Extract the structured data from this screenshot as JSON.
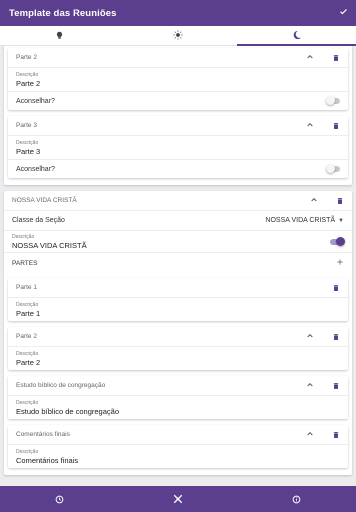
{
  "appbar": {
    "title": "Template das Reuniões",
    "check_icon": "check-icon"
  },
  "tabs": [
    {
      "icon": "lightbulb-icon"
    },
    {
      "icon": "sun-icon"
    },
    {
      "icon": "moon-icon",
      "active": true
    }
  ],
  "top_cards": [
    {
      "title": "Parte 2",
      "desc_label": "Descrição",
      "desc_value": "Parte 2",
      "advise_label": "Aconselhar?",
      "advise_on": false
    },
    {
      "title": "Parte 3",
      "desc_label": "Descrição",
      "desc_value": "Parte 3",
      "advise_label": "Aconselhar?",
      "advise_on": false
    }
  ],
  "section": {
    "title": "NOSSA VIDA CRISTÃ",
    "class_label": "Classe da Seção",
    "class_value": "NOSSA VIDA CRISTÃ",
    "desc_label": "Descrição",
    "desc_value": "NOSSA VIDA CRISTÃ",
    "desc_toggle_on": true,
    "partes_label": "PARTES",
    "parts": [
      {
        "title": "Parte 1",
        "desc_label": "Descrição",
        "desc_value": "Parte 1"
      },
      {
        "title": "Parte 2",
        "desc_label": "Descrição",
        "desc_value": "Parte 2"
      },
      {
        "title": "Estudo bíblico de congregação",
        "desc_label": "Descrição",
        "desc_value": "Estudo bíblico de congregação"
      },
      {
        "title": "Comentários finais",
        "desc_label": "Descrição",
        "desc_value": "Comentários finais"
      }
    ]
  },
  "bottom_nav": [
    {
      "icon": "timer-icon"
    },
    {
      "icon": "tools-icon"
    },
    {
      "icon": "info-icon"
    }
  ],
  "colors": {
    "primary": "#5b3f8e",
    "background": "#ececef"
  }
}
